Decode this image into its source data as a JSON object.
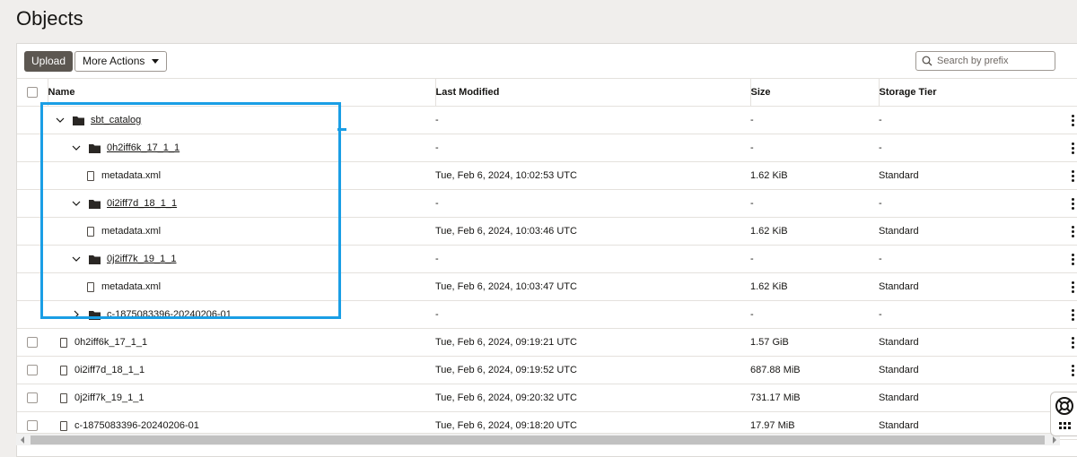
{
  "page": {
    "title": "Objects"
  },
  "toolbar": {
    "upload_label": "Upload",
    "more_actions_label": "More Actions",
    "search_placeholder": "Search by prefix"
  },
  "table": {
    "columns": [
      "Name",
      "Last Modified",
      "Size",
      "Storage Tier"
    ],
    "rows": [
      {
        "name": "sbt_catalog",
        "type": "folder",
        "expanded": true,
        "level": 0,
        "modified": "-",
        "size": "-",
        "tier": "-"
      },
      {
        "name": "0h2iff6k_17_1_1",
        "type": "folder",
        "expanded": true,
        "level": 1,
        "modified": "-",
        "size": "-",
        "tier": "-"
      },
      {
        "name": "metadata.xml",
        "type": "file",
        "level": 2,
        "modified": "Tue, Feb 6, 2024, 10:02:53 UTC",
        "size": "1.62 KiB",
        "tier": "Standard"
      },
      {
        "name": "0i2iff7d_18_1_1",
        "type": "folder",
        "expanded": true,
        "level": 1,
        "modified": "-",
        "size": "-",
        "tier": "-"
      },
      {
        "name": "metadata.xml",
        "type": "file",
        "level": 2,
        "modified": "Tue, Feb 6, 2024, 10:03:46 UTC",
        "size": "1.62 KiB",
        "tier": "Standard"
      },
      {
        "name": "0j2iff7k_19_1_1",
        "type": "folder",
        "expanded": true,
        "level": 1,
        "modified": "-",
        "size": "-",
        "tier": "-"
      },
      {
        "name": "metadata.xml",
        "type": "file",
        "level": 2,
        "modified": "Tue, Feb 6, 2024, 10:03:47 UTC",
        "size": "1.62 KiB",
        "tier": "Standard"
      },
      {
        "name": "c-1875083396-20240206-01",
        "type": "folder",
        "expanded": false,
        "level": 1,
        "modified": "-",
        "size": "-",
        "tier": "-"
      },
      {
        "name": "0h2iff6k_17_1_1",
        "type": "file",
        "level": 0,
        "checkbox": true,
        "modified": "Tue, Feb 6, 2024, 09:19:21 UTC",
        "size": "1.57 GiB",
        "tier": "Standard"
      },
      {
        "name": "0i2iff7d_18_1_1",
        "type": "file",
        "level": 0,
        "checkbox": true,
        "modified": "Tue, Feb 6, 2024, 09:19:52 UTC",
        "size": "687.88 MiB",
        "tier": "Standard"
      },
      {
        "name": "0j2iff7k_19_1_1",
        "type": "file",
        "level": 0,
        "checkbox": true,
        "modified": "Tue, Feb 6, 2024, 09:20:32 UTC",
        "size": "731.17 MiB",
        "tier": "Standard"
      },
      {
        "name": "c-1875083396-20240206-01",
        "type": "file",
        "level": 0,
        "checkbox": true,
        "modified": "Tue, Feb 6, 2024, 09:18:20 UTC",
        "size": "17.97 MiB",
        "tier": "Standard"
      }
    ]
  },
  "icons": {
    "search": "search-icon",
    "folder": "folder-icon",
    "file": "file-icon",
    "expand": "chevron-down-icon",
    "collapse": "chevron-right-icon",
    "kebab": "kebab-menu-icon",
    "help": "help-lifebuoy-icon",
    "apps": "apps-grid-icon"
  },
  "colors": {
    "upload_button": "#5c5751",
    "highlight": "#1a9ee5"
  }
}
